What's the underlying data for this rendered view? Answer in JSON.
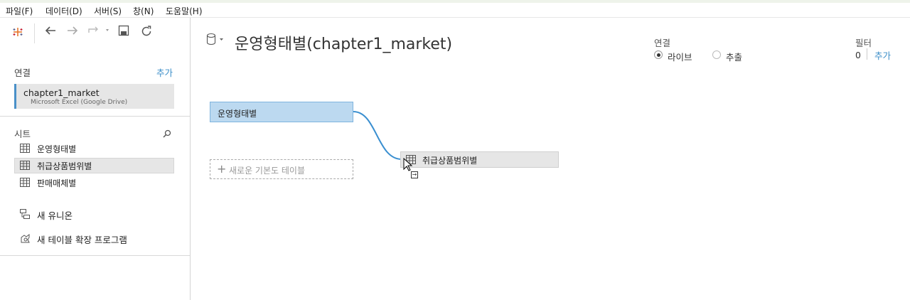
{
  "menubar": [
    "파일(F)",
    "데이터(D)",
    "서버(S)",
    "창(N)",
    "도움말(H)"
  ],
  "toolbar": {
    "icons": [
      "tableau-logo-icon",
      "back-icon",
      "forward-icon",
      "redo-icon",
      "save-icon",
      "refresh-icon"
    ]
  },
  "sidebar": {
    "connections_label": "연결",
    "add_label": "추가",
    "connection": {
      "name": "chapter1_market",
      "source": "Microsoft Excel (Google Drive)"
    },
    "sheets_label": "시트",
    "sheets": [
      {
        "label": "운영형태별",
        "selected": false
      },
      {
        "label": "취급상품범위별",
        "selected": true
      },
      {
        "label": "판매매체별",
        "selected": false
      }
    ],
    "new_union": "새 유니온",
    "new_table_extension": "새 테이블 확장 프로그램"
  },
  "main": {
    "datasource_title": "운영형태별(chapter1_market)",
    "connection_label": "연결",
    "connection_options": [
      {
        "label": "라이브",
        "selected": true
      },
      {
        "label": "추출",
        "selected": false
      }
    ],
    "filter_label": "필터",
    "filter_count": "0",
    "filter_add": "추가",
    "canvas": {
      "primary_table": "운영형태별",
      "new_logical_table": "새로운 기본도 테이블",
      "dragging_table": "취급상품범위별"
    }
  },
  "colors": {
    "accent": "#3b8ec8",
    "selected_table_fill": "#bcd9f0",
    "noodle": "#3a8fd0"
  }
}
